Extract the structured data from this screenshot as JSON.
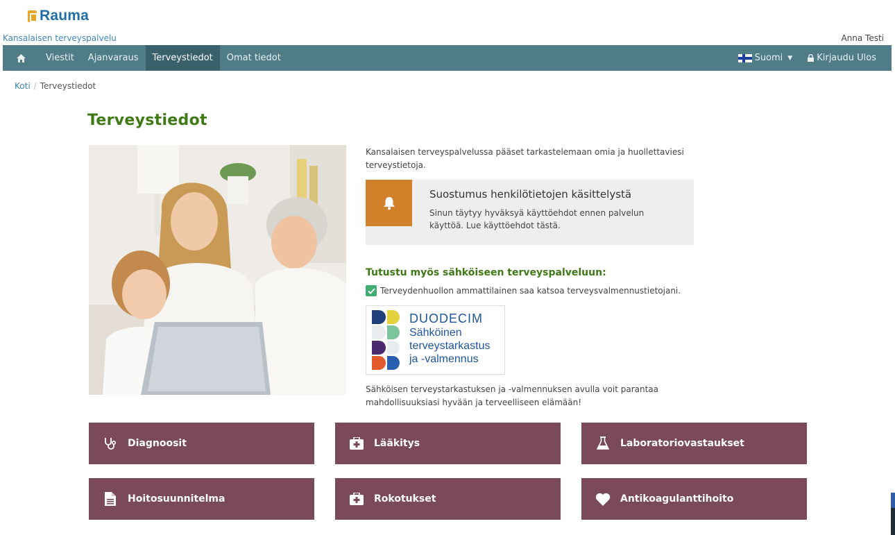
{
  "header": {
    "logo_text": "Rauma",
    "service_name": "Kansalaisen terveyspalvelu",
    "user_name": "Anna Testi"
  },
  "nav": {
    "home_icon": "home-icon",
    "items": [
      {
        "label": "Viestit",
        "active": false
      },
      {
        "label": "Ajanvaraus",
        "active": false
      },
      {
        "label": "Terveystiedot",
        "active": true
      },
      {
        "label": "Omat tiedot",
        "active": false
      }
    ],
    "language": "Suomi",
    "logout": "Kirjaudu Ulos",
    "bar_color": "#4f7c86"
  },
  "breadcrumb": {
    "home": "Koti",
    "separator": "/",
    "current": "Terveystiedot"
  },
  "page_title": "Terveystiedot",
  "intro": "Kansalaisen terveyspalvelussa pääset tarkastelemaan omia ja huollettaviesi terveystietoja.",
  "consent": {
    "title": "Suostumus henkilötietojen käsittelystä",
    "text": "Sinun täytyy hyväksyä käyttöehdot ennen palvelun käyttöä. Lue käyttöehdot tästä.",
    "icon": "bell-icon",
    "accent": "#d0812a"
  },
  "ehealth": {
    "heading": "Tutustu myös sähköiseen terveyspalveluun:",
    "checkbox_label": "Terveydenhuollon ammattilainen saa katsoa terveysvalmennustietojani.",
    "checked": true,
    "duodecim": {
      "brand": "DUODECIM",
      "lines": [
        "Sähköinen",
        "terveystarkastus",
        "ja -valmennus"
      ]
    },
    "outro": "Sähköisen terveystarkastuksen ja -valmennuksen avulla voit parantaa mahdollisuuksiasi hyvään ja terveelliseen elämään!"
  },
  "tiles": [
    {
      "label": "Diagnoosit",
      "icon": "stethoscope-icon"
    },
    {
      "label": "Lääkitys",
      "icon": "medkit-icon"
    },
    {
      "label": "Laboratoriovastaukset",
      "icon": "flask-icon"
    },
    {
      "label": "Hoitosuunnitelma",
      "icon": "document-icon"
    },
    {
      "label": "Rokotukset",
      "icon": "medkit-icon"
    },
    {
      "label": "Antikoagulanttihoito",
      "icon": "heart-icon"
    }
  ],
  "colors": {
    "title_green": "#3f7a17",
    "tile_bg": "#7a4a5a",
    "link_blue": "#3f86b8"
  }
}
